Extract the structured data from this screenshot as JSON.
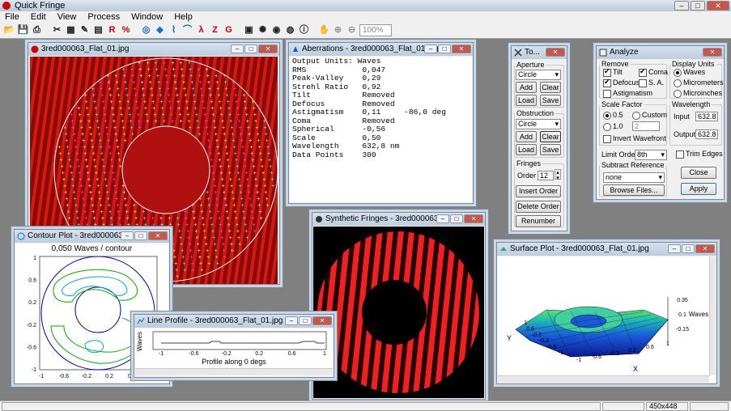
{
  "app": {
    "title": "Quick Fringe"
  },
  "menu": [
    "File",
    "Edit",
    "View",
    "Process",
    "Window",
    "Help"
  ],
  "toolbar": {
    "zoom": "100%",
    "r_label": "R",
    "z_label": "Z",
    "g_label": "G",
    "lambda": "λ"
  },
  "windows": {
    "interferogram": {
      "title": "3red000063_Flat_01.jpg"
    },
    "aberrations": {
      "title": "Aberrations - 3red000063_Flat_01.jpg",
      "lines": [
        "Output Units: Waves",
        "",
        "RMS            0,047",
        "Peak-Valley    0,29",
        "Strehl Ratio   0,92",
        "Tilt           Removed",
        "Defocus        Removed",
        "Astigmatism    0,11     -86,0 deg",
        "Coma           Removed",
        "Spherical      -0,56",
        "",
        "Scale          0,50",
        "Wavelength     632,8 nm",
        "Data Points    300"
      ]
    },
    "contour": {
      "title": "Contour Plot - 3red000063_F...",
      "subtitle": "0,050 Waves / contour",
      "yticks": [
        "1",
        "0.6",
        "0.2",
        "-0.2",
        "-0.6",
        "-1"
      ],
      "xticks": [
        "-1",
        "-0.6",
        "-0.2",
        "0.2",
        "0.6",
        "1"
      ]
    },
    "lineprofile": {
      "title": "Line Profile - 3red000063_Flat_01.jpg",
      "ylabel": "Waves",
      "xlabel": "Profile along 0 degs",
      "xticks": [
        "-1",
        "-0.6",
        "-0.2",
        "0.2",
        "0.6",
        "1"
      ]
    },
    "synthetic": {
      "title": "Synthetic Fringes - 3red000063_Flat..."
    },
    "surface": {
      "title": "Surface Plot - 3red000063_Flat_01.jpg",
      "zticks": [
        "0.35",
        "0.1",
        "-0.15"
      ],
      "zlabel": "Waves",
      "xlabel": "X",
      "ylabel": "Y",
      "yticks": [
        "1",
        "0.6",
        "0.2",
        "-0.2",
        "-0.6",
        "-1"
      ],
      "xticks": [
        "-1",
        "-0.6",
        "-0.2",
        "0.2",
        "0.6",
        "1"
      ]
    },
    "tools": {
      "title": "To...",
      "aperture_label": "Aperture",
      "aperture_value": "Circle",
      "add": "Add",
      "clear": "Clear",
      "load": "Load",
      "save": "Save",
      "obstruction_label": "Obstruction",
      "obstruction_value": "Circle",
      "fringes_label": "Fringes",
      "order_label": "Order",
      "order_value": "12",
      "insert_order": "Insert Order",
      "delete_order": "Delete Order",
      "renumber": "Renumber"
    },
    "analyze": {
      "title": "Analyze",
      "remove_label": "Remove",
      "tilt": "Tilt",
      "coma": "Coma",
      "defocus": "Defocus",
      "sa": "S. A.",
      "astig": "Astigmatism",
      "units_label": "Display Units",
      "waves": "Waves",
      "micrometers": "Micrometers",
      "microinches": "Microinches",
      "scale_label": "Scale Factor",
      "scale_05": "0.5",
      "scale_10": "1.0",
      "custom": "Custom",
      "custom_value": "2",
      "invert": "Invert Wavefront",
      "wavelength_label": "Wavelength",
      "input_label": "Input",
      "input_value": "632.8",
      "output_label": "Output",
      "output_value": "632.8",
      "limit_label": "Limit Order",
      "limit_value": "8th",
      "trim": "Trim Edges",
      "subtract_label": "Subtract Reference",
      "subtract_value": "none",
      "browse": "Browse Files...",
      "close": "Close",
      "apply": "Apply"
    }
  },
  "status": {
    "size": "450x448"
  },
  "colors": {
    "fringe": "#c01010",
    "background": "#808080",
    "titlebar": "#c9d6e3"
  }
}
